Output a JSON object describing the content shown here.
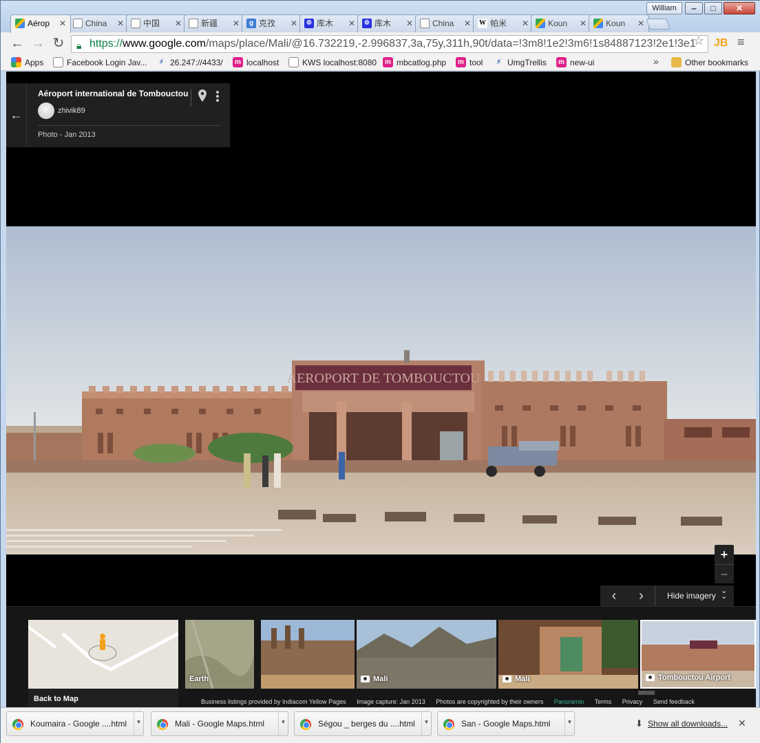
{
  "window": {
    "user": "William"
  },
  "tabs": [
    {
      "label": "Aérop",
      "icon": "google-maps-icon",
      "active": true
    },
    {
      "label": "China",
      "icon": "page-icon"
    },
    {
      "label": "中国",
      "icon": "page-icon"
    },
    {
      "label": "新疆",
      "icon": "page-icon"
    },
    {
      "label": "克孜",
      "icon": "google-icon"
    },
    {
      "label": "库木",
      "icon": "baidu-icon"
    },
    {
      "label": "库木",
      "icon": "baidu-icon"
    },
    {
      "label": "China",
      "icon": "page-icon"
    },
    {
      "label": "帕米",
      "icon": "wikipedia-icon"
    },
    {
      "label": "Koun",
      "icon": "google-maps-icon"
    },
    {
      "label": "Koun",
      "icon": "google-maps-icon"
    }
  ],
  "address": {
    "scheme": "https://",
    "host": "www.google.com",
    "path": "/maps/place/Mali/@16.732219,-2.996837,3a,75y,311h,90t/data=!3m8!1e2!3m6!1s84887123!2e1!3e1"
  },
  "bookmarks": {
    "items": [
      {
        "label": "Apps",
        "icon": "apps-grid-icon"
      },
      {
        "label": "Facebook Login Jav...",
        "icon": "page-icon"
      },
      {
        "label": "26.247://4433/",
        "icon": "link-icon"
      },
      {
        "label": "localhost",
        "icon": "bookmark-m-icon"
      },
      {
        "label": "KWS localhost:8080",
        "icon": "page-icon"
      },
      {
        "label": "mbcatlog.php",
        "icon": "bookmark-m-icon"
      },
      {
        "label": "tool",
        "icon": "bookmark-m-icon"
      },
      {
        "label": "UmgTrellis",
        "icon": "link-icon"
      },
      {
        "label": "new-ui",
        "icon": "bookmark-m-icon"
      }
    ],
    "more": "»",
    "other": "Other bookmarks"
  },
  "card": {
    "title": "Aéroport international de Tombouctou",
    "author": "zhivik89",
    "date": "Photo - Jan 2013"
  },
  "photo": {
    "sign": "AEROPORT DE TOMBOUCTOU"
  },
  "controls": {
    "hide_imagery": "Hide imagery"
  },
  "thumbnails": {
    "back_to_map": "Back to Map",
    "items": [
      {
        "label": "Earth"
      },
      {
        "label": ""
      },
      {
        "label": "Mali"
      },
      {
        "label": "Mali"
      },
      {
        "label": "Tombouctou Airport"
      }
    ]
  },
  "footer": {
    "listings": "Business listings provided by Indiacom Yellow Pages",
    "capture": "Image capture: Jan 2013",
    "copyright": "Photos are copyrighted by their owners",
    "panoramio": "Panoramio",
    "terms": "Terms",
    "privacy": "Privacy",
    "feedback": "Send feedback"
  },
  "downloads": {
    "items": [
      {
        "name": "Koumaira - Google ....html"
      },
      {
        "name": "Mali - Google Maps.html"
      },
      {
        "name": "Ségou _ berges du ....html"
      },
      {
        "name": "San - Google Maps.html"
      }
    ],
    "show_all": "Show all downloads..."
  }
}
